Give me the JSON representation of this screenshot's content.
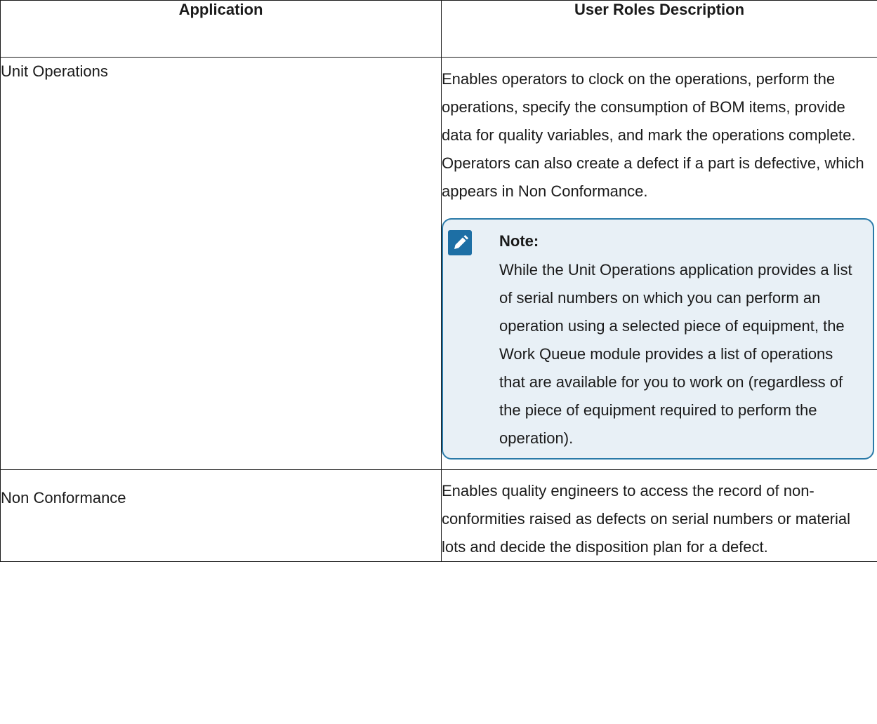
{
  "table": {
    "headers": {
      "application": "Application",
      "description": "User Roles Description"
    },
    "rows": [
      {
        "application": "Unit Operations",
        "description": "Enables operators to clock on the operations, per­form the operations, specify the consumption of BOM items, provide data for quality variables, and mark the operations complete. Operators can also create a defect if a part is defective, which appears in Non Conformance.",
        "note": {
          "title": "Note:",
          "text": "While the Unit Operations application pro­vides a list of serial numbers on which you can perform an operation using a selected piece of equipment, the Work Queue mod­ule provides a list of operations that are available for you to work on (regardless of the piece of equipment required to per­form the operation)."
        }
      },
      {
        "application": "Non Conformance",
        "description": "Enables quality engineers to access the record of non-conformities raised as defects on serial num­bers or material lots and decide the disposition plan for a defect."
      }
    ]
  },
  "icons": {
    "note": "pencil-icon"
  },
  "colors": {
    "note_background": "#e8f0f6",
    "note_border": "#2a7aa8",
    "note_icon": "#1d6fa5",
    "table_border": "#1a1a1a"
  }
}
